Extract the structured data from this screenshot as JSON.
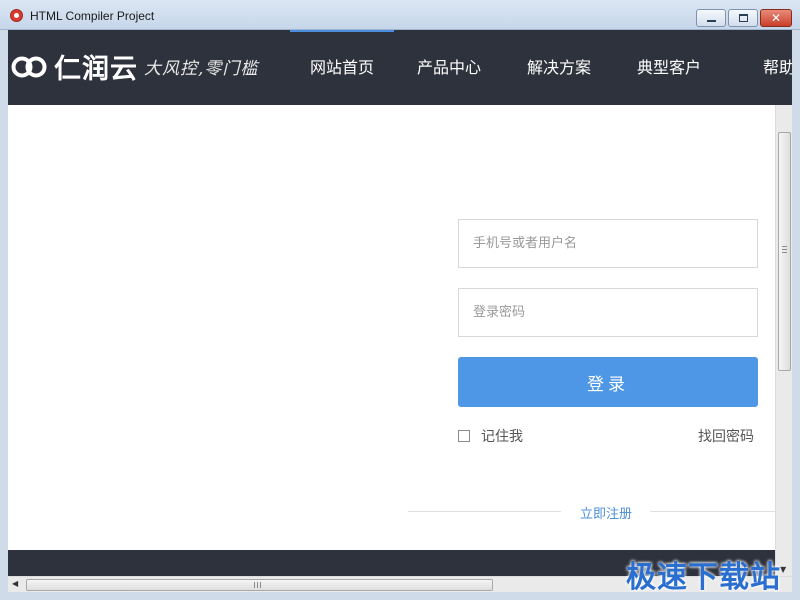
{
  "window": {
    "title": "HTML Compiler Project"
  },
  "nav": {
    "brand": "仁润云",
    "slogan": "大风控,零门槛",
    "items": [
      {
        "label": "网站首页"
      },
      {
        "label": "产品中心"
      },
      {
        "label": "解决方案"
      },
      {
        "label": "典型客户"
      },
      {
        "label": "帮助"
      }
    ]
  },
  "login": {
    "username_placeholder": "手机号或者用户名",
    "password_placeholder": "登录密码",
    "submit_label": "登录",
    "remember_label": "记住我",
    "forgot_label": "找回密码",
    "register_label": "立即注册"
  },
  "watermark": "极速下载站",
  "colors": {
    "nav_bg": "#2e323c",
    "accent": "#4d97e6",
    "link": "#4d8fd6"
  }
}
